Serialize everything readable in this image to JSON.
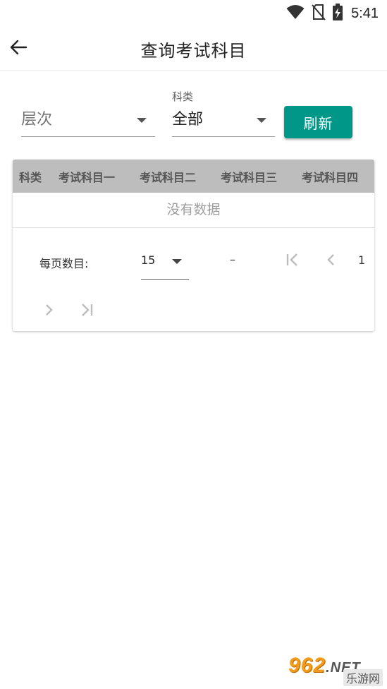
{
  "status_bar": {
    "time": "5:41",
    "icons": [
      "wifi-icon",
      "no-sim-icon",
      "battery-charging-icon"
    ]
  },
  "app_bar": {
    "title": "查询考试科目",
    "back_icon": "arrow-left-icon"
  },
  "filters": {
    "level": {
      "value": "层次"
    },
    "subject": {
      "label": "科类",
      "value": "全部"
    },
    "refresh_label": "刷新",
    "accent_color": "#009688"
  },
  "table": {
    "columns": [
      "科类",
      "考试科目一",
      "考试科目二",
      "考试科目三",
      "考试科目四"
    ],
    "rows": [],
    "empty_text": "没有数据",
    "header_bg": "#bdbdbd"
  },
  "pagination": {
    "rows_per_page_label": "每页数目:",
    "rows_per_page": "15",
    "range": "–",
    "page": "1",
    "icons": [
      "first-page-icon",
      "prev-page-icon",
      "next-page-icon",
      "last-page-icon"
    ]
  },
  "watermark": {
    "top": "962",
    "net": ".NET",
    "bottom": "乐游网"
  }
}
